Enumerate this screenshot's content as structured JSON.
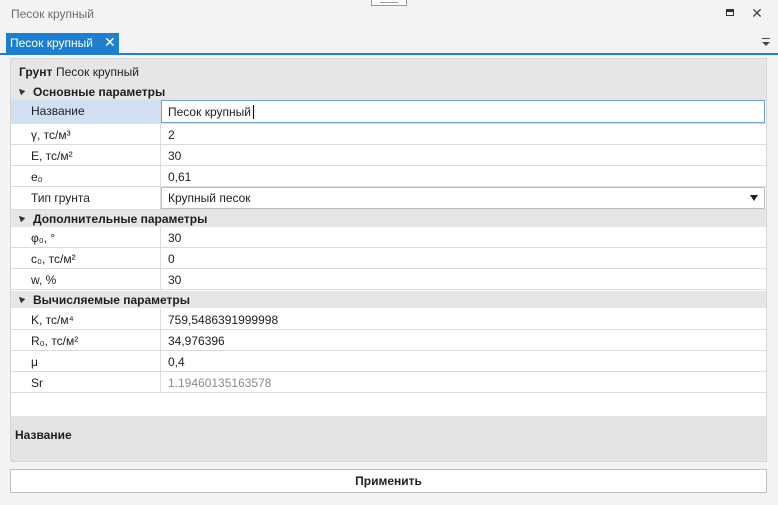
{
  "window": {
    "title": "Песок крупный"
  },
  "tab": {
    "label": "Песок крупный",
    "close_glyph": "✕"
  },
  "header": {
    "label": "Грунт",
    "value": "Песок крупный"
  },
  "sections": {
    "basic": {
      "title": "Основные параметры",
      "name": {
        "key": "Название",
        "value": "Песок крупный"
      },
      "gamma": {
        "key": "γ, тс/м³",
        "value": "2"
      },
      "E": {
        "key": "E, тс/м²",
        "value": "30"
      },
      "e0": {
        "key": "e₀",
        "value": "0,61"
      },
      "soil_type": {
        "key": "Тип грунта",
        "value": "Крупный песок"
      }
    },
    "extra": {
      "title": "Дополнительные параметры",
      "phi": {
        "key": "φ₀, °",
        "value": "30"
      },
      "c0": {
        "key": "c₀, тс/м²",
        "value": "0"
      },
      "w": {
        "key": "w, %",
        "value": "30"
      }
    },
    "computed": {
      "title": "Вычисляемые параметры",
      "K": {
        "key": "K, тс/м⁴",
        "value": "759,5486391999998"
      },
      "R0": {
        "key": "R₀, тс/м²",
        "value": "34,976396"
      },
      "mu": {
        "key": "μ",
        "value": "0,4"
      },
      "Sr": {
        "key": "Sr",
        "value": "1.19460135163578"
      }
    }
  },
  "description": {
    "title": "Название"
  },
  "apply_button": {
    "label": "Применить"
  },
  "colors": {
    "accent": "#1e7fd1",
    "selected_row": "#cfe0f2",
    "section_bg": "#e6e6e6"
  }
}
